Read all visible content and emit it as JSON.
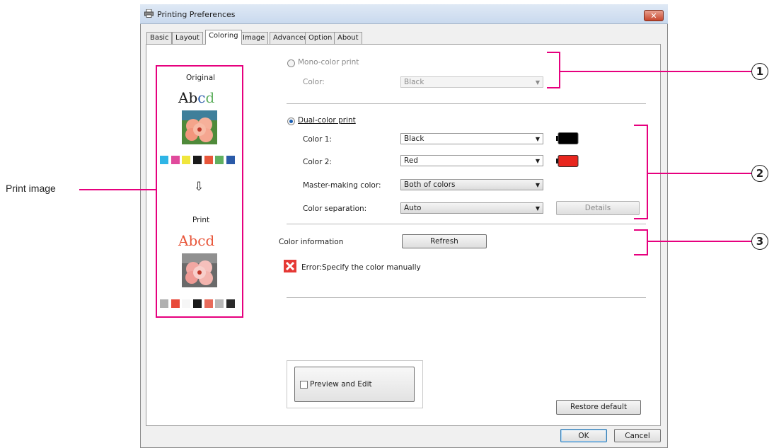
{
  "window": {
    "title": "Printing Preferences",
    "close_glyph": "✕"
  },
  "tabs": [
    {
      "label": "Basic"
    },
    {
      "label": "Layout"
    },
    {
      "label": "Coloring"
    },
    {
      "label": "Image"
    },
    {
      "label": "Advanced"
    },
    {
      "label": "Option"
    },
    {
      "label": "About"
    }
  ],
  "preview": {
    "original_label": "Original",
    "abcd_text": "Abcd",
    "arrow_glyph": "⇩",
    "print_label": "Print",
    "original_colors": [
      "#2fb5e6",
      "#e04a9c",
      "#f0e63c",
      "#1a1a1a",
      "#e8563a",
      "#60b060",
      "#2a5aa8"
    ],
    "print_colors": [
      "#b0b0b0",
      "#e84a3a",
      "#f6f6f6",
      "#1a1a1a",
      "#e86a5a",
      "#b8b8b8",
      "#2a2a2a"
    ]
  },
  "mono": {
    "label": "Mono-color print",
    "color_label": "Color:",
    "color_value": "Black"
  },
  "dual": {
    "label": "Dual-color print",
    "color1_label": "Color 1:",
    "color1_value": "Black",
    "color2_label": "Color 2:",
    "color2_value": "Red",
    "master_label": "Master-making color:",
    "master_value": "Both of colors",
    "separation_label": "Color separation:",
    "separation_value": "Auto",
    "details_button": "Details"
  },
  "color_info": {
    "label": "Color information",
    "refresh_button": "Refresh",
    "error_text": "Error:Specify the color manually"
  },
  "preview_edit_label": "Preview and Edit",
  "buttons": {
    "restore": "Restore default",
    "ok": "OK",
    "cancel": "Cancel"
  },
  "annotations": {
    "print_image": "Print image",
    "callout1": "1",
    "callout2": "2",
    "callout3": "3"
  },
  "colors": {
    "accent": "#e6007e",
    "black_ink": "#000000",
    "red_ink": "#e8261e"
  }
}
